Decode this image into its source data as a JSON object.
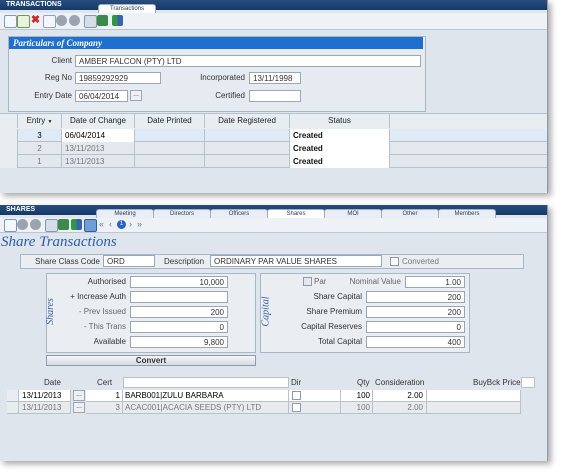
{
  "transactions_window": {
    "title": "TRANSACTIONS",
    "tab": "Transactions",
    "section_header": "Particulars of Company",
    "client_label": "Client",
    "client_value": "AMBER FALCON (PTY) LTD",
    "regno_label": "Reg No",
    "regno_value": "19859292929",
    "incorporated_label": "Incorporated",
    "incorporated_value": "13/11/1998",
    "entry_date_label": "Entry Date",
    "entry_date_value": "06/04/2014",
    "certified_label": "Certified",
    "certified_value": "",
    "ellipsis": "...",
    "grid": {
      "headers": [
        "Entry",
        "Date of Change",
        "Date Printed",
        "Date Registered",
        "Status"
      ],
      "rows": [
        {
          "entry": "3",
          "date_of_change": "06/04/2014",
          "date_printed": "",
          "date_registered": "",
          "status": "Created"
        },
        {
          "entry": "2",
          "date_of_change": "13/11/2013",
          "date_printed": "",
          "date_registered": "",
          "status": "Created"
        },
        {
          "entry": "1",
          "date_of_change": "13/11/2013",
          "date_printed": "",
          "date_registered": "",
          "status": "Created"
        }
      ]
    }
  },
  "shares_window": {
    "title": "SHARES",
    "tabs": [
      "Meeting",
      "Directors",
      "Officers",
      "Shares",
      "MOI",
      "Other",
      "Members"
    ],
    "active_tab": "Shares",
    "record_nav": "1",
    "heading": "Share Transactions",
    "share_class_label": "Share Class Code",
    "share_class_value": "ORD",
    "description_label": "Description",
    "description_value": "ORDINARY PAR VALUE SHARES",
    "converted_label": "Converted",
    "shares_group": {
      "title": "Shares",
      "authorised_label": "Authorised",
      "authorised_value": "10,000",
      "increase_label": "+ Increase Auth",
      "increase_value": "",
      "prev_label": "- Prev Issued",
      "prev_value": "200",
      "this_label": "- This Trans",
      "this_value": "0",
      "available_label": "Available",
      "available_value": "9,800",
      "convert_button": "Convert"
    },
    "capital_group": {
      "title": "Capital",
      "par_label": "Par",
      "nominal_label": "Nominal Value",
      "nominal_value": "1.00",
      "share_capital_label": "Share Capital",
      "share_capital_value": "200",
      "share_premium_label": "Share Premium",
      "share_premium_value": "200",
      "capital_reserves_label": "Capital Reserves",
      "capital_reserves_value": "0",
      "total_capital_label": "Total Capital",
      "total_capital_value": "400"
    },
    "grid": {
      "headers": [
        "Date",
        "Cert",
        "",
        "Dir",
        "Qty",
        "Consideration",
        "BuyBck Price"
      ],
      "rows": [
        {
          "date": "13/11/2013",
          "cert": "1",
          "member": "BARB001|ZULU BARBARA",
          "qty": "100",
          "consideration": "2.00"
        },
        {
          "date": "13/11/2013",
          "cert": "3",
          "member": "ACAC001|ACACIA SEEDS (PTY) LTD",
          "qty": "100",
          "consideration": "2.00"
        }
      ]
    }
  },
  "colors": {
    "titlebar": "#1c3f6e",
    "section_header": "#1f6fd1",
    "selected_row": "#dfeaf7"
  }
}
